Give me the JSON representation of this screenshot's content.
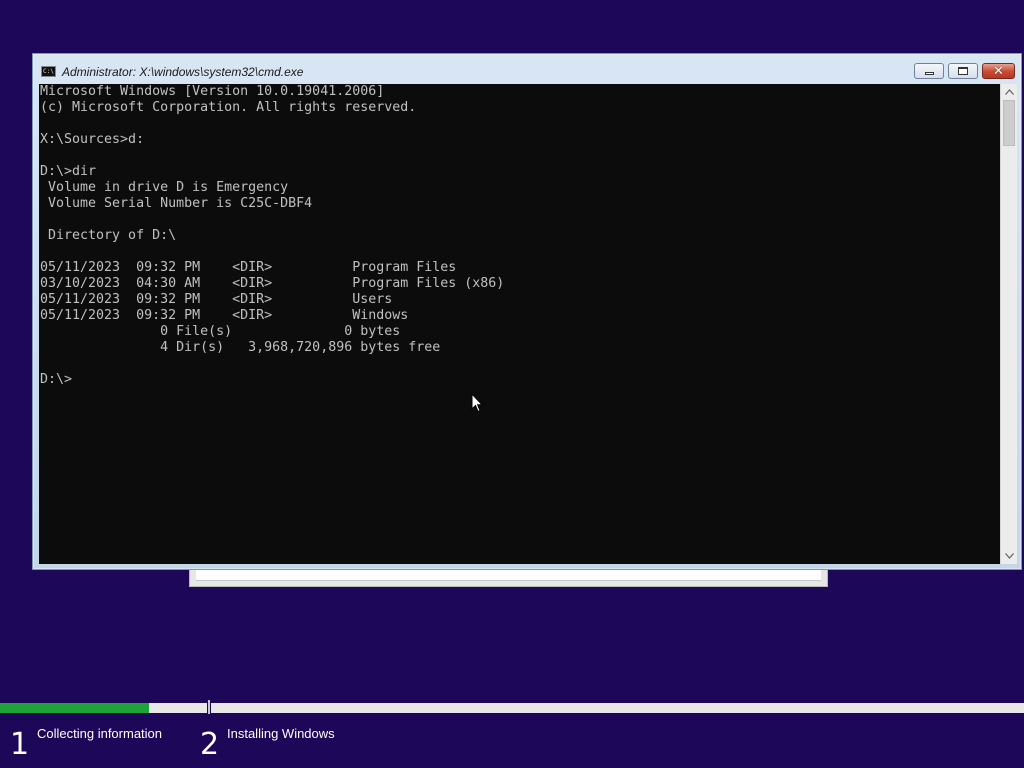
{
  "window": {
    "title": "Administrator: X:\\windows\\system32\\cmd.exe",
    "icon_text": "C:\\"
  },
  "console": {
    "lines": [
      "Microsoft Windows [Version 10.0.19041.2006]",
      "(c) Microsoft Corporation. All rights reserved.",
      "",
      "X:\\Sources>d:",
      "",
      "D:\\>dir",
      " Volume in drive D is Emergency",
      " Volume Serial Number is C25C-DBF4",
      "",
      " Directory of D:\\",
      "",
      "05/11/2023  09:32 PM    <DIR>          Program Files",
      "03/10/2023  04:30 AM    <DIR>          Program Files (x86)",
      "05/11/2023  09:32 PM    <DIR>          Users",
      "05/11/2023  09:32 PM    <DIR>          Windows",
      "               0 File(s)              0 bytes",
      "               4 Dir(s)   3,968,720,896 bytes free",
      "",
      "D:\\>"
    ]
  },
  "setup_progress": {
    "steps": [
      {
        "number": "1",
        "label": "Collecting information"
      },
      {
        "number": "2",
        "label": "Installing Windows"
      }
    ],
    "step1_progress": 0.72,
    "fill_color": "#1fa43a"
  },
  "colors": {
    "desktop_background": "#1d0759",
    "console_background": "#0c0c0c",
    "console_text": "#c0c0c0"
  }
}
